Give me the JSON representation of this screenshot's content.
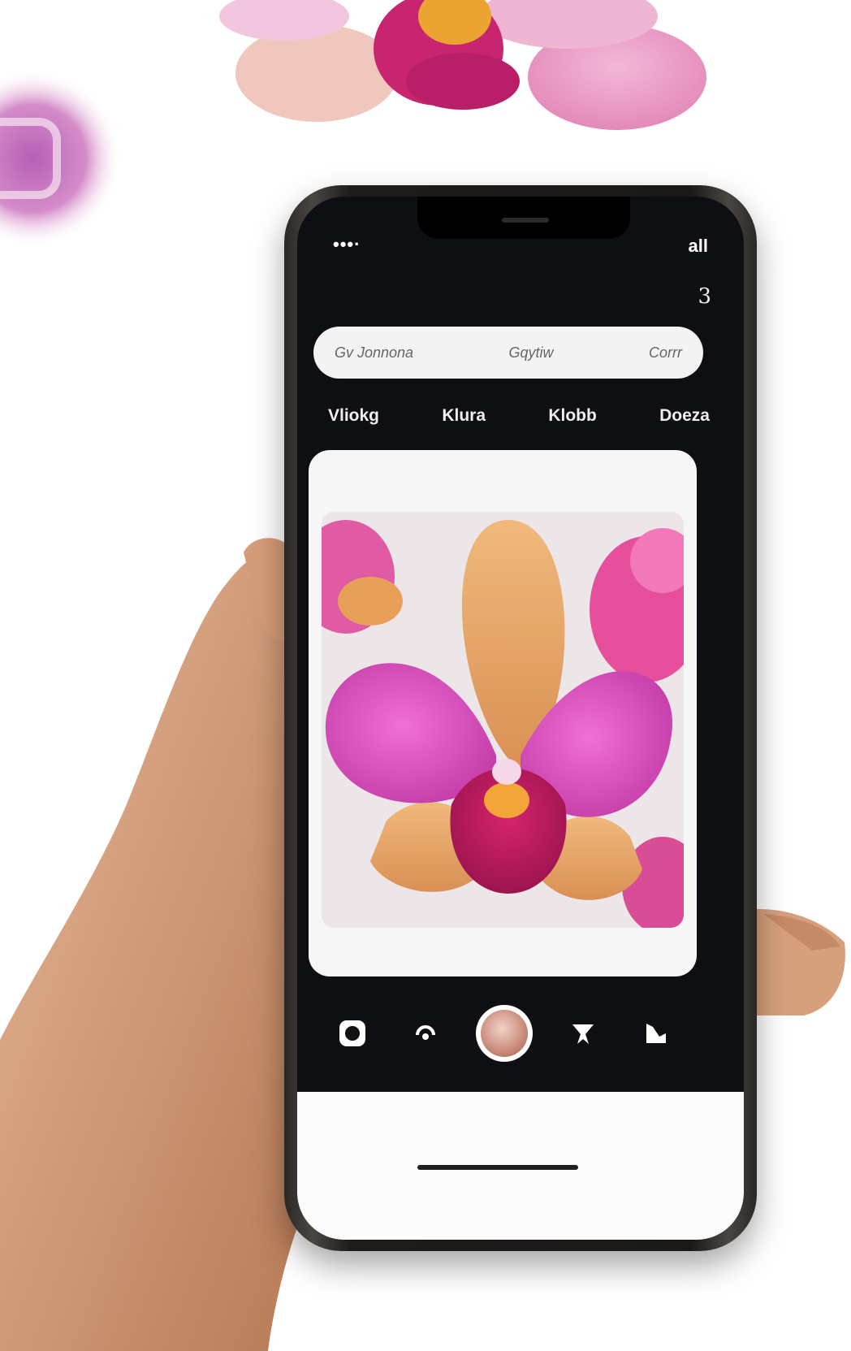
{
  "status": {
    "left": "•••·",
    "right": "all"
  },
  "top_icon": "3",
  "search": {
    "left": "Gv Jonnona",
    "middle": "Gqytiw",
    "right": "Corrr"
  },
  "tabs": [
    {
      "label": "Vliokg"
    },
    {
      "label": "Klura"
    },
    {
      "label": "Klobb"
    },
    {
      "label": "Doeza"
    }
  ],
  "toolbar": {
    "icons": [
      "gallery-icon",
      "rotate-icon",
      "capture-button",
      "bookmark-icon",
      "crop-icon"
    ]
  },
  "colors": {
    "orchid_pink": "#d94bc0",
    "orchid_peach": "#e8a66b",
    "screen_bg": "#0e0f12",
    "skin": "#d9a37f"
  }
}
